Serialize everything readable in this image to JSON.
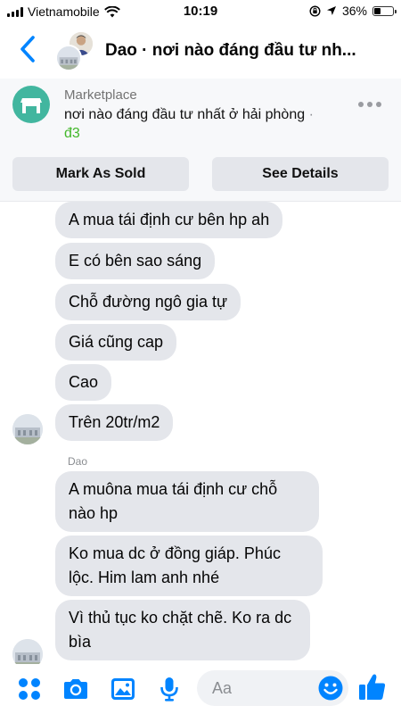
{
  "status_bar": {
    "carrier": "Vietnamobile",
    "time": "10:19",
    "battery": "36%",
    "battery_level": 0.36
  },
  "header": {
    "title": "Dao · nơi nào đáng đầu tư nh..."
  },
  "marketplace": {
    "label": "Marketplace",
    "title": "nơi nào đáng đầu tư nhất ở hải phòng",
    "separator": "·",
    "price": "đ3",
    "mark_sold_label": "Mark As Sold",
    "see_details_label": "See Details"
  },
  "messages_group1": [
    "A mua tái định cư bên hp ah",
    "E có bên sao sáng",
    "Chỗ đường ngô gia tự",
    "Giá cũng cap",
    "Cao",
    "Trên 20tr/m2"
  ],
  "group2_sender": "Dao",
  "messages_group2": [
    "A muôna mua tái định cư chỗ nào hp",
    "Ko mua dc ở đồng giáp. Phúc lộc. Him lam anh nhé",
    "Vì thủ tục ko chặt chẽ. Ko ra dc bìa"
  ],
  "composer": {
    "placeholder": "Aa"
  },
  "colors": {
    "accent": "#0084ff",
    "bubble": "#e4e6eb",
    "price_green": "#42b72a",
    "marketplace_icon": "#42b69f"
  },
  "icons": {
    "back": "chevron-left-icon",
    "more": "more-dots-icon",
    "apps": "apps-grid-icon",
    "camera": "camera-icon",
    "gallery": "gallery-icon",
    "mic": "microphone-icon",
    "emoji": "emoji-icon",
    "like": "thumbs-up-icon"
  }
}
